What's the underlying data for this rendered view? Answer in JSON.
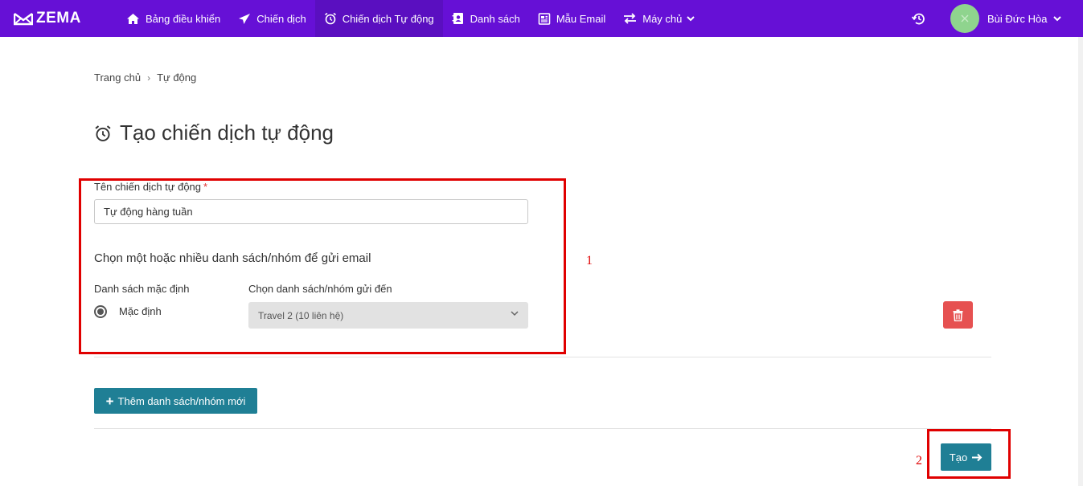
{
  "brand": {
    "name": "ZEMA",
    "icon": "envelope-logo-icon"
  },
  "nav": {
    "items": [
      {
        "label": "Bảng điều khiển",
        "icon": "home-icon"
      },
      {
        "label": "Chiến dịch",
        "icon": "paper-plane-icon"
      },
      {
        "label": "Chiến dịch Tự động",
        "icon": "alarm-clock-icon",
        "active": true
      },
      {
        "label": "Danh sách",
        "icon": "address-book-icon"
      },
      {
        "label": "Mẫu Email",
        "icon": "newspaper-icon"
      },
      {
        "label": "Máy chủ",
        "icon": "exchange-arrows-icon",
        "dropdown": true
      }
    ]
  },
  "user": {
    "name": "Bùi Đức Hòa",
    "avatar_color": "#8fd48e"
  },
  "breadcrumb": {
    "home": "Trang chủ",
    "current": "Tự động",
    "separator": "›"
  },
  "page": {
    "title": "Tạo chiến dịch tự động"
  },
  "form": {
    "name_label": "Tên chiến dịch tự động",
    "required_mark": "*",
    "name_value": "Tự động hàng tuần",
    "section_title": "Chọn một hoặc nhiều danh sách/nhóm để gửi email",
    "default_list_label": "Danh sách mặc định",
    "default_radio_label": "Mặc định",
    "select_label": "Chọn danh sách/nhóm gửi đến",
    "select_value": "Travel 2 (10 liên hệ)"
  },
  "buttons": {
    "add_list": "Thêm danh sách/nhóm mới",
    "create": "Tạo"
  },
  "annotations": {
    "box1": "1",
    "box2": "2"
  },
  "colors": {
    "topbar": "#6610d6",
    "primary_button": "#1f7f95",
    "danger_button": "#e65151",
    "annotation": "#e00000"
  }
}
